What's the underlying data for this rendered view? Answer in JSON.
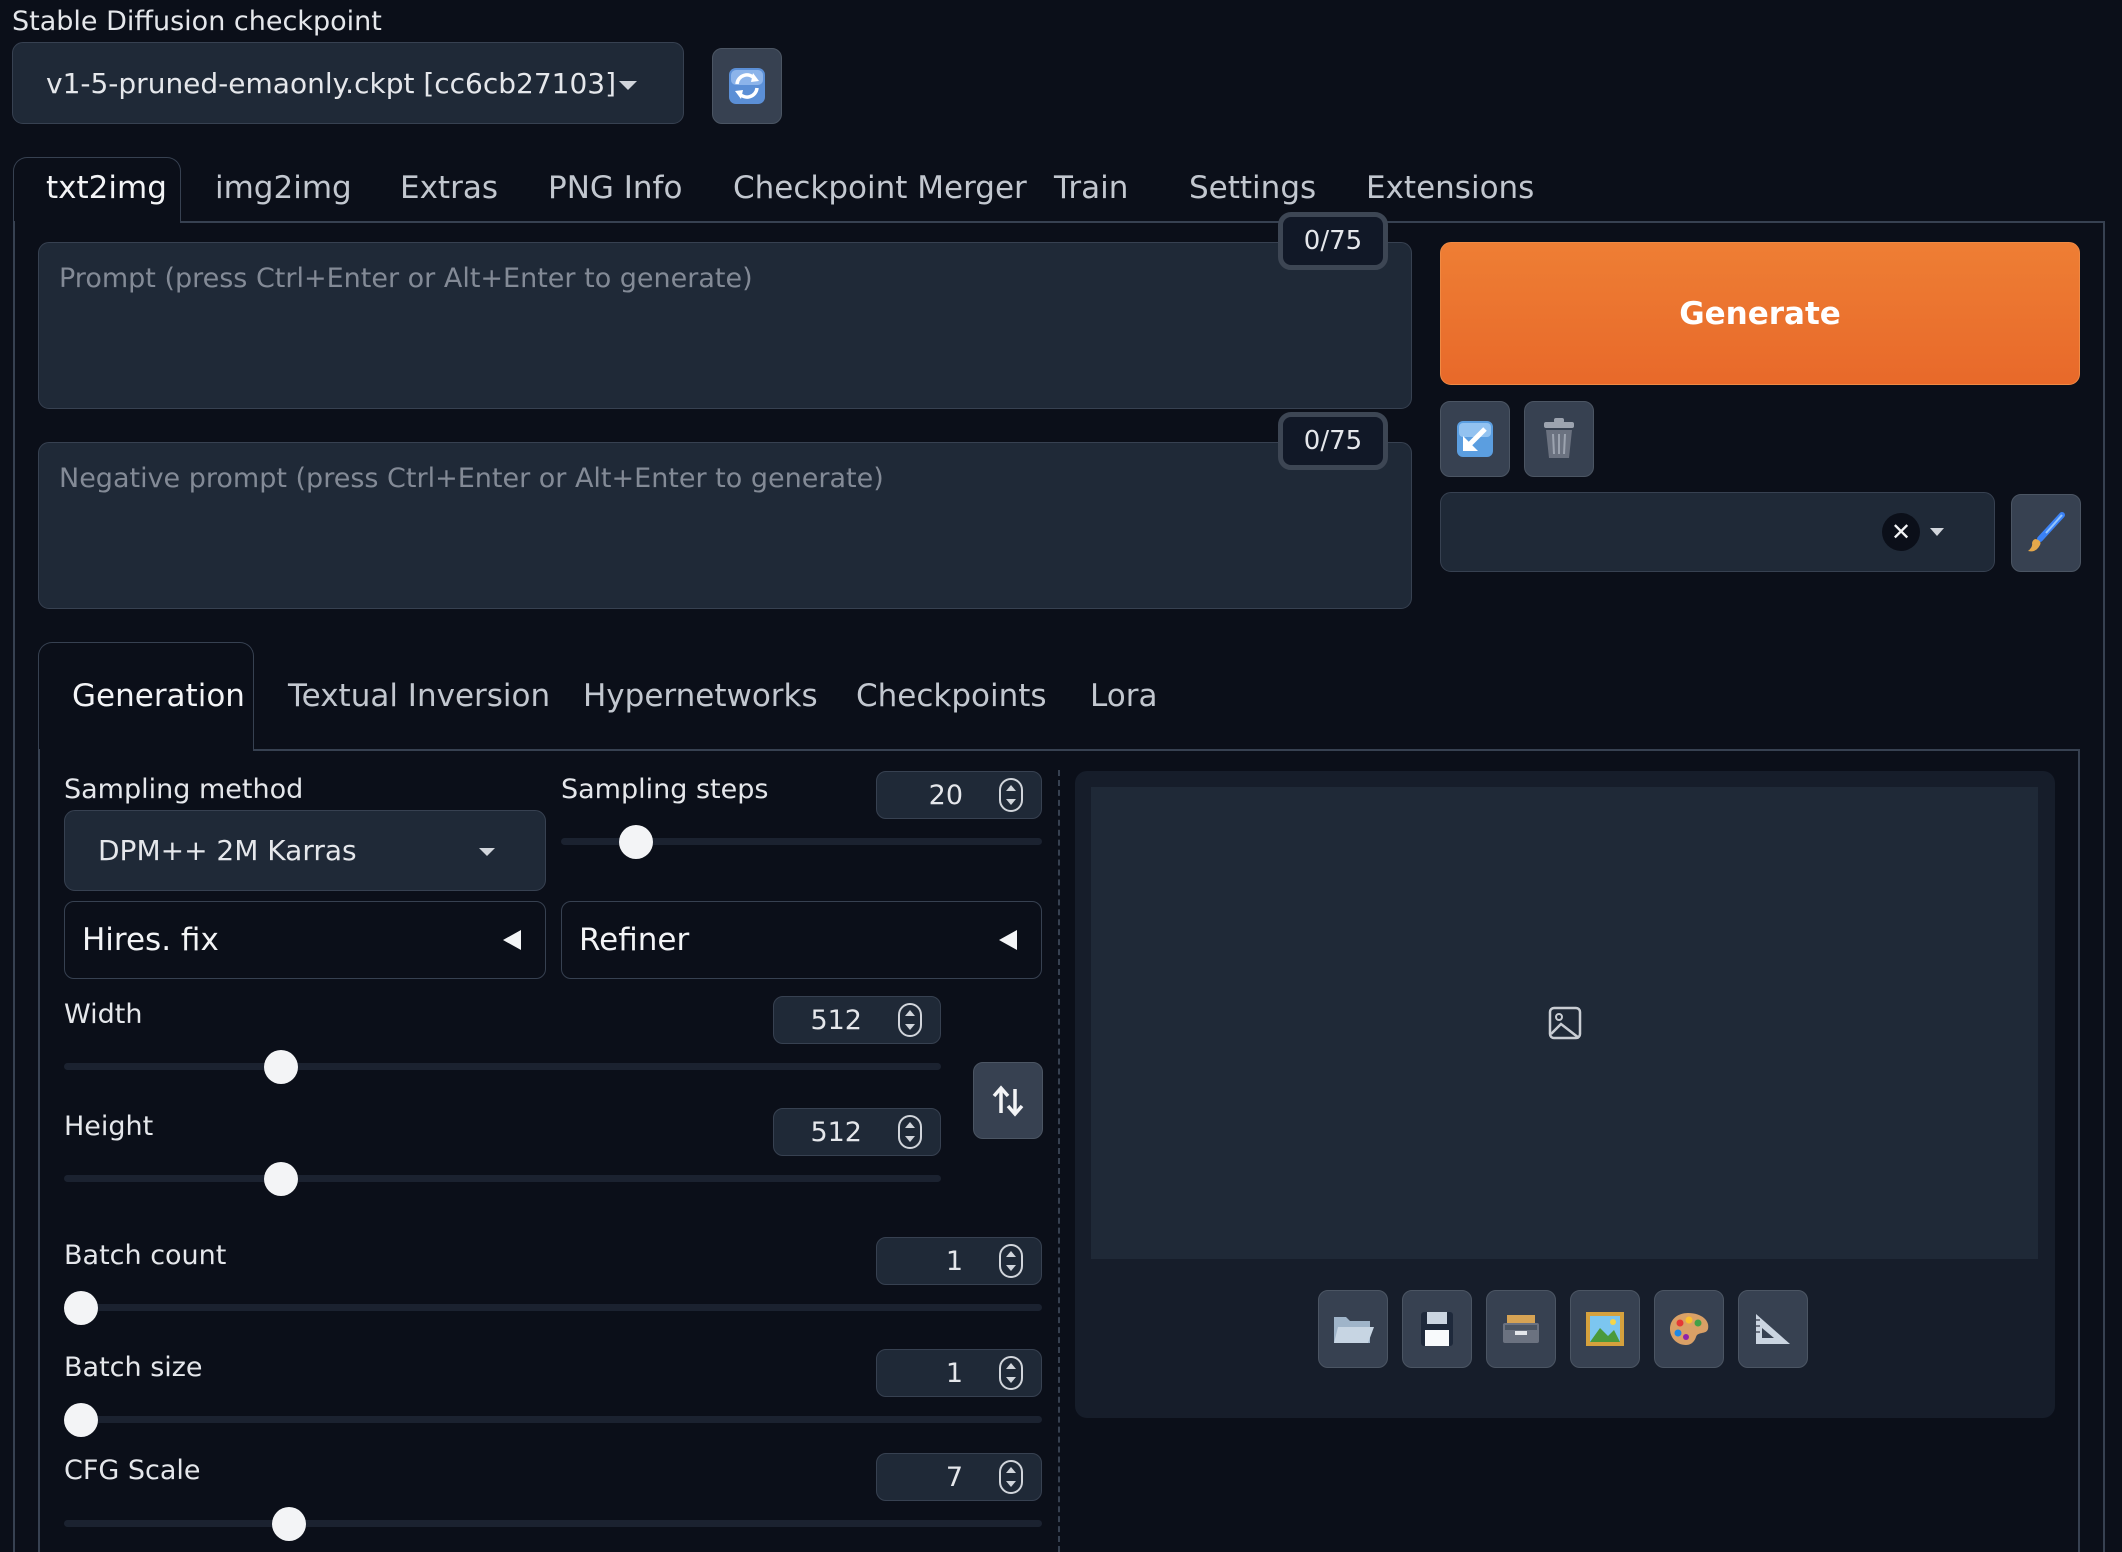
{
  "checkpoint": {
    "label": "Stable Diffusion checkpoint",
    "value": "v1-5-pruned-emaonly.ckpt [cc6cb27103]"
  },
  "main_tabs": [
    "txt2img",
    "img2img",
    "Extras",
    "PNG Info",
    "Checkpoint Merger",
    "Train",
    "Settings",
    "Extensions"
  ],
  "prompt": {
    "placeholder": "Prompt (press Ctrl+Enter or Alt+Enter to generate)",
    "counter": "0/75"
  },
  "negative_prompt": {
    "placeholder": "Negative prompt (press Ctrl+Enter or Alt+Enter to generate)",
    "counter": "0/75"
  },
  "generate_label": "Generate",
  "sub_tabs": [
    "Generation",
    "Textual Inversion",
    "Hypernetworks",
    "Checkpoints",
    "Lora"
  ],
  "sampling": {
    "method_label": "Sampling method",
    "method_value": "DPM++ 2M Karras",
    "steps_label": "Sampling steps",
    "steps_value": "20",
    "steps_fraction": 0.13
  },
  "accordions": {
    "hires": "Hires. fix",
    "refiner": "Refiner"
  },
  "dimensions": {
    "width_label": "Width",
    "width_value": "512",
    "width_fraction": 0.237,
    "height_label": "Height",
    "height_value": "512",
    "height_fraction": 0.237
  },
  "batch": {
    "count_label": "Batch count",
    "count_value": "1",
    "count_fraction": 0.0,
    "size_label": "Batch size",
    "size_value": "1",
    "size_fraction": 0.0
  },
  "cfg": {
    "label": "CFG Scale",
    "value": "7",
    "fraction": 0.22
  },
  "icons": {
    "refresh": "refresh-icon",
    "paste": "arrow-down-left-icon",
    "trash": "trash-icon",
    "clear": "x-circle-icon",
    "brush": "paintbrush-icon",
    "swap": "swap-vertical-icon",
    "image_placeholder": "image-icon",
    "folder": "folder-icon",
    "save": "floppy-disk-icon",
    "zip": "zip-archive-icon",
    "send_img2img": "framed-picture-icon",
    "send_inpaint": "palette-icon",
    "send_extras": "triangle-ruler-icon"
  },
  "colors": {
    "background": "#0b0f19",
    "panel": "#1f2937",
    "border": "#374151",
    "accent": "#e8692a"
  }
}
